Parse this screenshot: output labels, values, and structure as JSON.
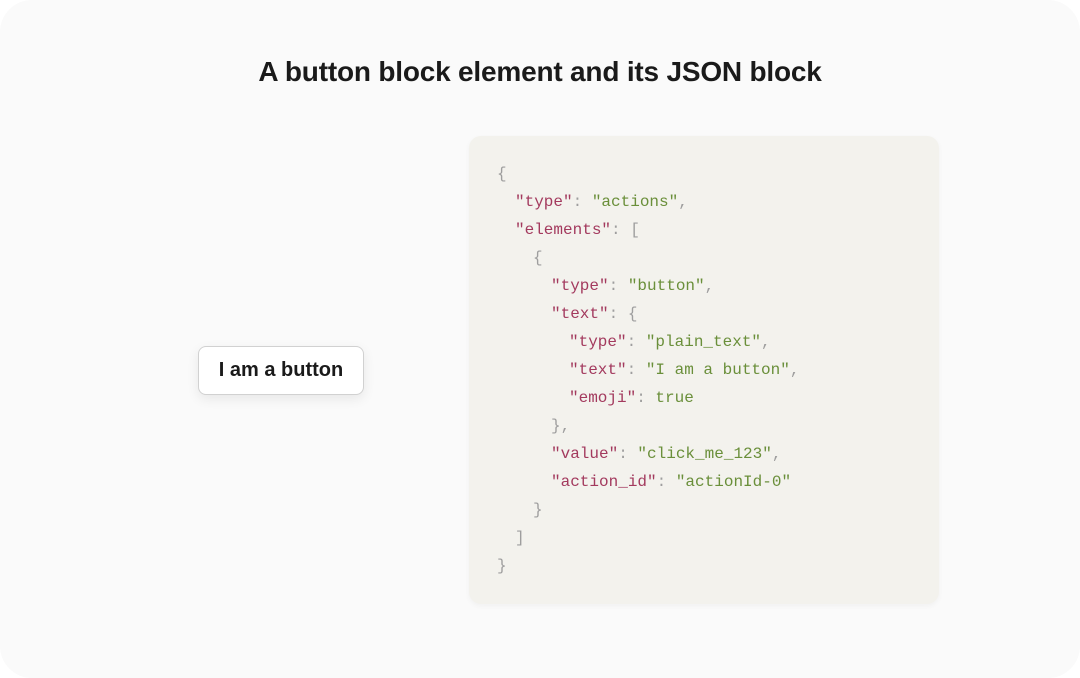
{
  "title": "A button block element and its JSON block",
  "button": {
    "label": "I am a button"
  },
  "code": {
    "lines": [
      {
        "indent": 0,
        "tokens": [
          {
            "cls": "p",
            "t": "{"
          }
        ]
      },
      {
        "indent": 1,
        "tokens": [
          {
            "cls": "k",
            "t": "\"type\""
          },
          {
            "cls": "p",
            "t": ": "
          },
          {
            "cls": "s",
            "t": "\"actions\""
          },
          {
            "cls": "p",
            "t": ","
          }
        ]
      },
      {
        "indent": 1,
        "tokens": [
          {
            "cls": "k",
            "t": "\"elements\""
          },
          {
            "cls": "p",
            "t": ": ["
          }
        ]
      },
      {
        "indent": 2,
        "tokens": [
          {
            "cls": "p",
            "t": "{"
          }
        ]
      },
      {
        "indent": 3,
        "tokens": [
          {
            "cls": "k",
            "t": "\"type\""
          },
          {
            "cls": "p",
            "t": ": "
          },
          {
            "cls": "s",
            "t": "\"button\""
          },
          {
            "cls": "p",
            "t": ","
          }
        ]
      },
      {
        "indent": 3,
        "tokens": [
          {
            "cls": "k",
            "t": "\"text\""
          },
          {
            "cls": "p",
            "t": ": {"
          }
        ]
      },
      {
        "indent": 4,
        "tokens": [
          {
            "cls": "k",
            "t": "\"type\""
          },
          {
            "cls": "p",
            "t": ": "
          },
          {
            "cls": "s",
            "t": "\"plain_text\""
          },
          {
            "cls": "p",
            "t": ","
          }
        ]
      },
      {
        "indent": 4,
        "tokens": [
          {
            "cls": "k",
            "t": "\"text\""
          },
          {
            "cls": "p",
            "t": ": "
          },
          {
            "cls": "s",
            "t": "\"I am a button\""
          },
          {
            "cls": "p",
            "t": ","
          }
        ]
      },
      {
        "indent": 4,
        "tokens": [
          {
            "cls": "k",
            "t": "\"emoji\""
          },
          {
            "cls": "p",
            "t": ": "
          },
          {
            "cls": "b",
            "t": "true"
          }
        ]
      },
      {
        "indent": 3,
        "tokens": [
          {
            "cls": "p",
            "t": "},"
          }
        ]
      },
      {
        "indent": 3,
        "tokens": [
          {
            "cls": "k",
            "t": "\"value\""
          },
          {
            "cls": "p",
            "t": ": "
          },
          {
            "cls": "s",
            "t": "\"click_me_123\""
          },
          {
            "cls": "p",
            "t": ","
          }
        ]
      },
      {
        "indent": 3,
        "tokens": [
          {
            "cls": "k",
            "t": "\"action_id\""
          },
          {
            "cls": "p",
            "t": ": "
          },
          {
            "cls": "s",
            "t": "\"actionId-0\""
          }
        ]
      },
      {
        "indent": 2,
        "tokens": [
          {
            "cls": "p",
            "t": "}"
          }
        ]
      },
      {
        "indent": 1,
        "tokens": [
          {
            "cls": "p",
            "t": "]"
          }
        ]
      },
      {
        "indent": 0,
        "tokens": [
          {
            "cls": "p",
            "t": "}"
          }
        ]
      }
    ]
  }
}
